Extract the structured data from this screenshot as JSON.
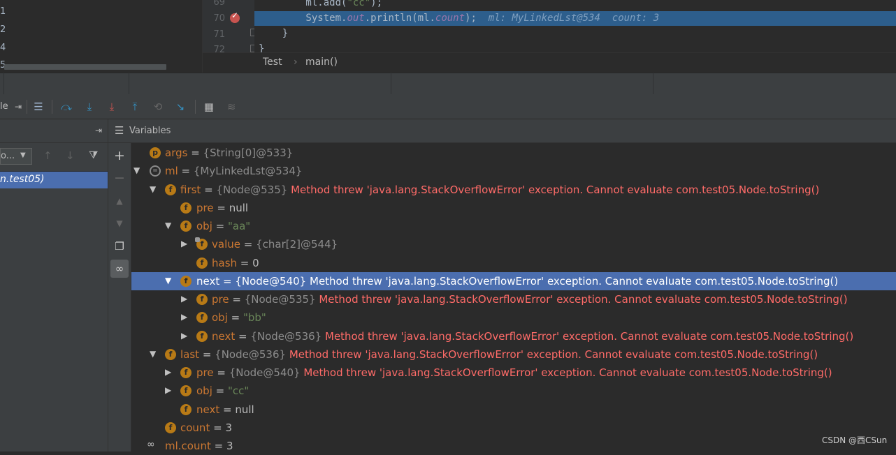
{
  "project": {
    "numbers": [
      "1",
      "2",
      "4",
      "5"
    ]
  },
  "editor": {
    "lines": [
      {
        "num": "69",
        "code_pre": "        ml.add(",
        "str": "\"cc\"",
        "code_post": ");"
      },
      {
        "num": "70",
        "code_pre": "        System.",
        "field1": "out",
        "mid": ".println(ml.",
        "field2": "count",
        "code_post": ");",
        "inline": "  ml: MyLinkedLst@534  count: 3"
      },
      {
        "num": "71",
        "code": "    }"
      },
      {
        "num": "72",
        "code": "}"
      }
    ],
    "breadcrumb": [
      "Test",
      "main()"
    ]
  },
  "toolbar": {
    "partial_label": "le"
  },
  "frames": {
    "select_text": "o...",
    "selected_frame": "n.test05)"
  },
  "variables": {
    "title": "Variables",
    "rows": [
      {
        "icon": "p",
        "name": "args",
        "ref": "{String[0]@533}"
      },
      {
        "name": "ml",
        "ref": "{MyLinkedLst@534}",
        "expanded": true
      },
      {
        "icon": "f",
        "name": "first",
        "ref": "{Node@535}",
        "err": "Method threw 'java.lang.StackOverflowError' exception. Cannot evaluate com.test05.Node.toString()",
        "expanded": true
      },
      {
        "icon": "f",
        "name": "pre",
        "val": "null"
      },
      {
        "icon": "f",
        "name": "obj",
        "str": "\"aa\"",
        "expanded": true
      },
      {
        "icon": "f",
        "name": "value",
        "ref": "{char[2]@544}",
        "collapsed": true
      },
      {
        "icon": "f",
        "name": "hash",
        "val": "0"
      },
      {
        "icon": "f",
        "name": "next",
        "ref": "{Node@540}",
        "err": "Method threw 'java.lang.StackOverflowError' exception. Cannot evaluate com.test05.Node.toString()",
        "expanded": true,
        "selected": true
      },
      {
        "icon": "f",
        "name": "pre",
        "ref": "{Node@535}",
        "err": "Method threw 'java.lang.StackOverflowError' exception. Cannot evaluate com.test05.Node.toString()",
        "collapsed": true
      },
      {
        "icon": "f",
        "name": "obj",
        "str": "\"bb\"",
        "collapsed": true
      },
      {
        "icon": "f",
        "name": "next",
        "ref": "{Node@536}",
        "err": "Method threw 'java.lang.StackOverflowError' exception. Cannot evaluate com.test05.Node.toString()",
        "collapsed": true
      },
      {
        "icon": "f",
        "name": "last",
        "ref": "{Node@536}",
        "err": "Method threw 'java.lang.StackOverflowError' exception. Cannot evaluate com.test05.Node.toString()",
        "expanded": true
      },
      {
        "icon": "f",
        "name": "pre",
        "ref": "{Node@540}",
        "err": "Method threw 'java.lang.StackOverflowError' exception. Cannot evaluate com.test05.Node.toString()",
        "collapsed": true
      },
      {
        "icon": "f",
        "name": "obj",
        "str": "\"cc\"",
        "collapsed": true
      },
      {
        "icon": "f",
        "name": "next",
        "val": "null"
      },
      {
        "icon": "f",
        "name": "count",
        "val": "3"
      },
      {
        "name": "ml.count",
        "val": "3",
        "watch": true
      }
    ]
  },
  "watermark": "CSDN @西CSun",
  "colors": {
    "selection": "#4b6eaf",
    "error": "#ff6b68",
    "string": "#6a8759",
    "field_icon": "#b87a16",
    "var_name": "#cc7832"
  }
}
